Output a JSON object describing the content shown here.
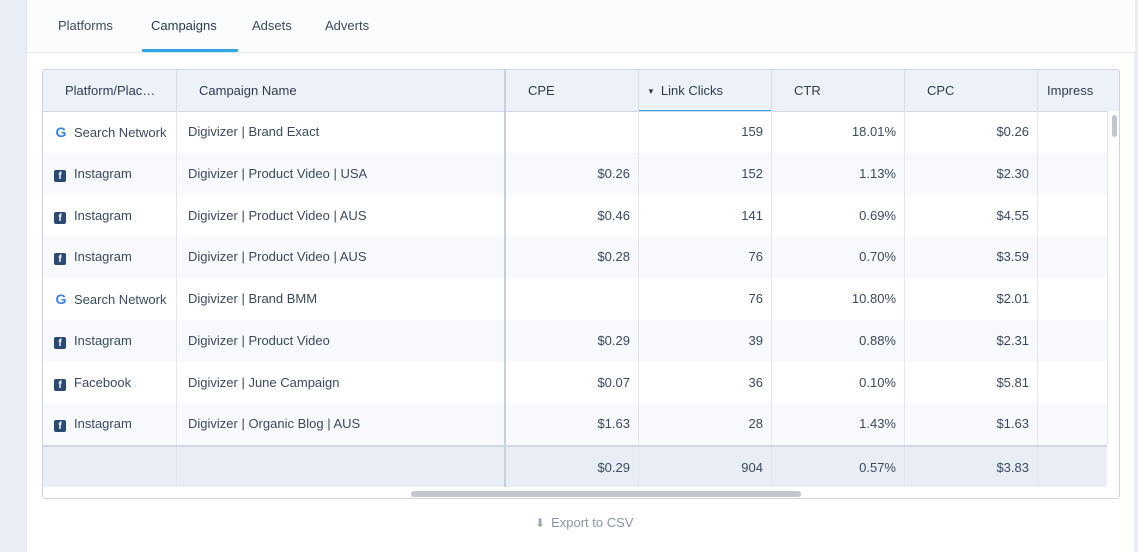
{
  "tabs": [
    {
      "label": "Platforms"
    },
    {
      "label": "Campaigns",
      "active": true
    },
    {
      "label": "Adsets"
    },
    {
      "label": "Adverts"
    }
  ],
  "table": {
    "columns": [
      {
        "label": "Platform/Plac…"
      },
      {
        "label": "Campaign Name"
      },
      {
        "label": "CPE"
      },
      {
        "label": "Link Clicks",
        "sorted": "desc"
      },
      {
        "label": "CTR"
      },
      {
        "label": "CPC"
      },
      {
        "label": "Impress"
      }
    ],
    "rows": [
      {
        "icon": "google-icon",
        "platform": "Search Network",
        "campaign": "Digivizer | Brand Exact",
        "cpe": "",
        "link_clicks": "159",
        "ctr": "18.01%",
        "cpc": "$0.26"
      },
      {
        "icon": "facebook-icon",
        "platform": "Instagram",
        "campaign": "Digivizer | Product Video | USA",
        "cpe": "$0.26",
        "link_clicks": "152",
        "ctr": "1.13%",
        "cpc": "$2.30"
      },
      {
        "icon": "facebook-icon",
        "platform": "Instagram",
        "campaign": "Digivizer | Product Video | AUS",
        "cpe": "$0.46",
        "link_clicks": "141",
        "ctr": "0.69%",
        "cpc": "$4.55"
      },
      {
        "icon": "facebook-icon",
        "platform": "Instagram",
        "campaign": "Digivizer | Product Video | AUS",
        "cpe": "$0.28",
        "link_clicks": "76",
        "ctr": "0.70%",
        "cpc": "$3.59"
      },
      {
        "icon": "google-icon",
        "platform": "Search Network",
        "campaign": "Digivizer | Brand BMM",
        "cpe": "",
        "link_clicks": "76",
        "ctr": "10.80%",
        "cpc": "$2.01"
      },
      {
        "icon": "facebook-icon",
        "platform": "Instagram",
        "campaign": "Digivizer | Product Video",
        "cpe": "$0.29",
        "link_clicks": "39",
        "ctr": "0.88%",
        "cpc": "$2.31"
      },
      {
        "icon": "facebook-icon",
        "platform": "Facebook",
        "campaign": "Digivizer | June Campaign",
        "cpe": "$0.07",
        "link_clicks": "36",
        "ctr": "0.10%",
        "cpc": "$5.81"
      },
      {
        "icon": "facebook-icon",
        "platform": "Instagram",
        "campaign": "Digivizer | Organic Blog | AUS",
        "cpe": "$1.63",
        "link_clicks": "28",
        "ctr": "1.43%",
        "cpc": "$1.63"
      }
    ],
    "totals": {
      "cpe": "$0.29",
      "link_clicks": "904",
      "ctr": "0.57%",
      "cpc": "$3.83"
    }
  },
  "export": {
    "label": "Export to CSV",
    "icon": "download-icon"
  },
  "colors": {
    "accent": "#2fa6e6",
    "google_blue": "#3b82e6",
    "facebook_navy": "#2b4a73"
  }
}
